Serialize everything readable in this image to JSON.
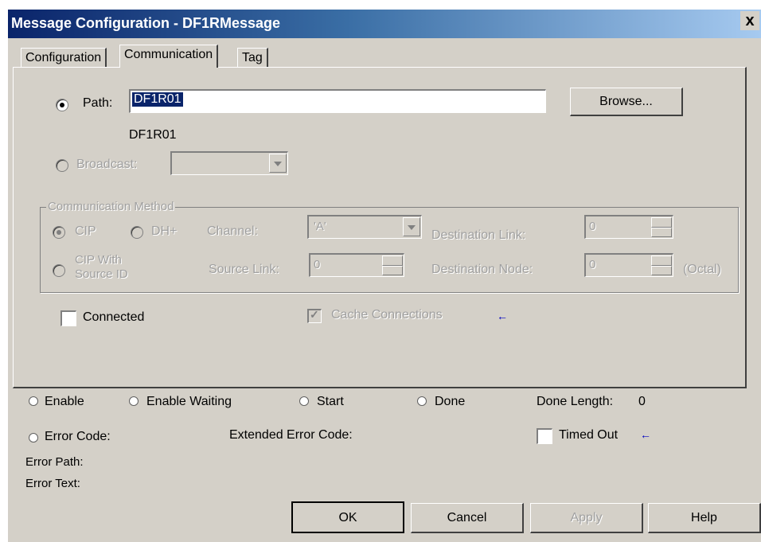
{
  "window": {
    "title": "Message Configuration - DF1RMessage",
    "close_symbol": "x"
  },
  "tabs": [
    {
      "label": "Configuration",
      "active": false
    },
    {
      "label": "Communication",
      "active": true
    },
    {
      "label": "Tag",
      "active": false
    }
  ],
  "path": {
    "label": "Path:",
    "value": "DF1R01",
    "resolved": "DF1R01",
    "browse_label": "Browse..."
  },
  "broadcast": {
    "label": "Broadcast:",
    "value": ""
  },
  "comm_method": {
    "title": "Communication Method",
    "cip_label": "CIP",
    "dhplus_label": "DH+",
    "cip_source_label_line1": "CIP With",
    "cip_source_label_line2": "Source ID",
    "channel_label": "Channel:",
    "channel_value": "'A'",
    "dest_link_label": "Destination Link:",
    "dest_link_value": "0",
    "source_link_label": "Source Link:",
    "source_link_value": "0",
    "dest_node_label": "Destination Node:",
    "dest_node_value": "0",
    "octal_label": "(Octal)"
  },
  "connected": {
    "label": "Connected",
    "checked": false
  },
  "cache": {
    "label": "Cache Connections",
    "checked": true
  },
  "status": {
    "enable": "Enable",
    "enable_waiting": "Enable Waiting",
    "start": "Start",
    "done": "Done",
    "done_length_label": "Done Length:",
    "done_length_value": "0",
    "error_code": "Error Code:",
    "extended_error_code": "Extended Error Code:",
    "timed_out": "Timed Out",
    "error_path": "Error Path:",
    "error_text": "Error Text:"
  },
  "buttons": {
    "ok": "OK",
    "cancel": "Cancel",
    "apply": "Apply",
    "help": "Help"
  },
  "arrow_glyph": "←",
  "colors": {
    "titlebar_start": "#0a246a",
    "titlebar_end": "#a6caf0",
    "dialog_bg": "#d4d0c8",
    "selection": "#0a246a"
  }
}
